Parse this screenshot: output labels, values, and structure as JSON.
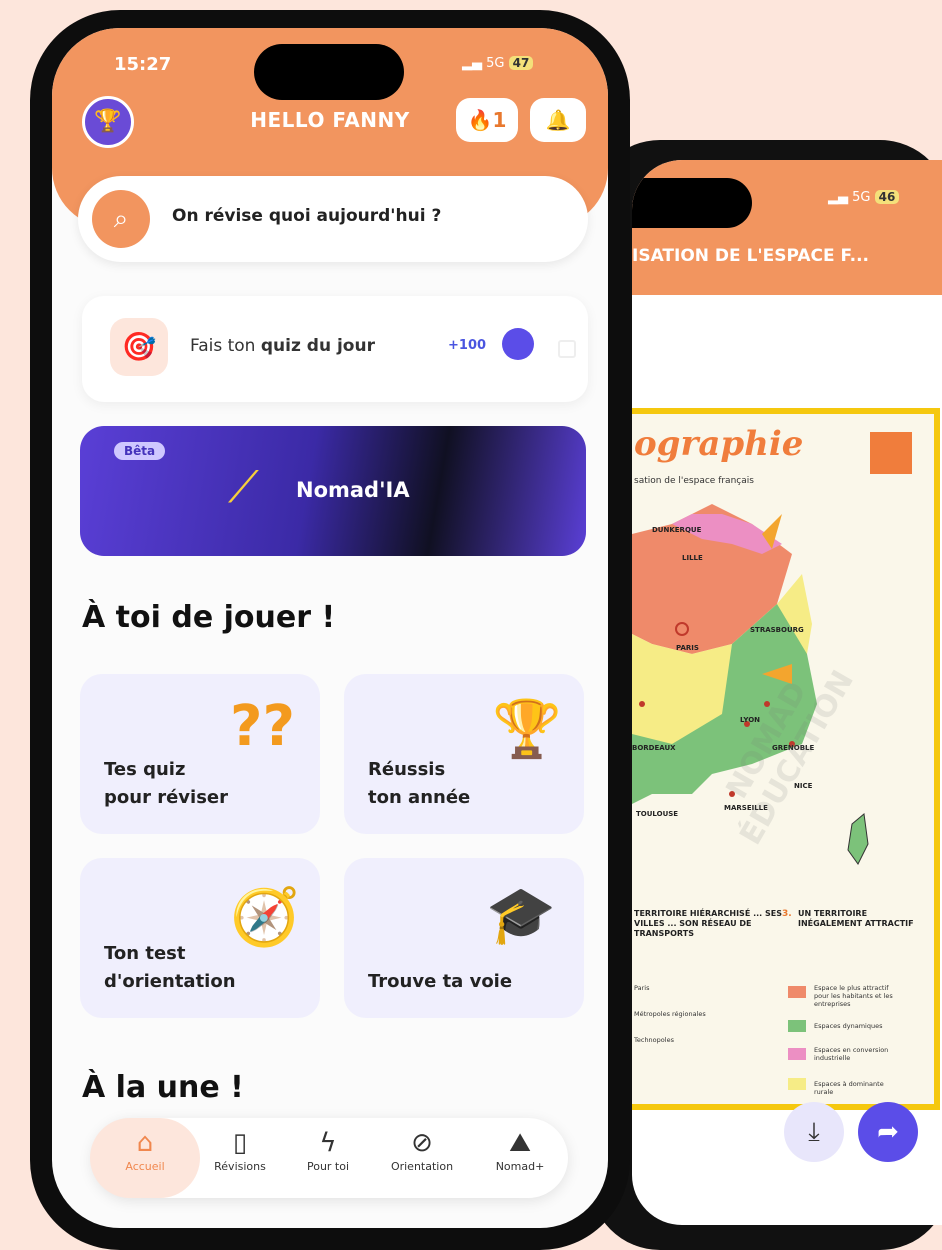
{
  "back_phone": {
    "status_signal": "5G",
    "battery": "46",
    "title": "ISATION DE L'ESPACE F...",
    "doc": {
      "title": "ographie",
      "subtitle": "sation de l'espace français",
      "map_labels": [
        "DUNKERQUE",
        "LILLE",
        "PARIS",
        "STRASBOURG",
        "LYON",
        "GRENOBLE",
        "NICE",
        "MARSEILLE",
        "TOULOUSE",
        "BORDEAUX"
      ],
      "section_left": "TERRITOIRE HIÉRARCHISÉ ... SES VILLES ... SON RÉSEAU DE TRANSPORTS",
      "section_right_num": "3.",
      "section_right": "UN TERRITOIRE INÉGALEMENT ATTRACTIF",
      "left_items": [
        "Paris",
        "Métropoles régionales",
        "Technopoles"
      ],
      "legend": [
        {
          "color": "#ef8a6a",
          "label": "Espace le plus attractif pour les habitants et les entreprises"
        },
        {
          "color": "#7cc27a",
          "label": "Espaces dynamiques"
        },
        {
          "color": "#ec8fc3",
          "label": "Espaces en conversion industrielle"
        },
        {
          "color": "#f6ec86",
          "label": "Espaces à dominante rurale"
        }
      ],
      "watermark": "NOMAD ÉDUCATION"
    },
    "download_icon": "download-icon",
    "share_icon": "share-icon"
  },
  "front_phone": {
    "time": "15:27",
    "status_signal": "5G",
    "battery": "47",
    "greeting": "HELLO FANNY",
    "streak_count": "1",
    "search_placeholder": "On révise quoi aujourd'hui ?",
    "daily_quiz": {
      "prefix": "Fais ton ",
      "bold": "quiz du jour",
      "points": "+100"
    },
    "nomad_ia": {
      "badge": "Bêta",
      "label": "Nomad'IA"
    },
    "section_play": "À toi de jouer !",
    "cards": [
      {
        "line1": "Tes quiz",
        "line2": "pour réviser",
        "icon": "question-marks-icon"
      },
      {
        "line1": "Réussis",
        "line2": "ton année",
        "icon": "trophy-icon"
      },
      {
        "line1": "Ton test",
        "line2": "d'orientation",
        "icon": "compass-icon"
      },
      {
        "line1": "",
        "line2": "Trouve ta voie",
        "icon": "graduation-cap-icon"
      }
    ],
    "section_news": "À la une !",
    "nav": [
      {
        "label": "Accueil",
        "icon": "home-icon"
      },
      {
        "label": "Révisions",
        "icon": "book-icon"
      },
      {
        "label": "Pour toi",
        "icon": "lightning-icon"
      },
      {
        "label": "Orientation",
        "icon": "compass-icon"
      },
      {
        "label": "Nomad+",
        "icon": "mountain-sparkle-icon"
      }
    ]
  },
  "colors": {
    "orange": "#f2955f",
    "purple": "#5b4de8",
    "background": "#fde6dc"
  }
}
